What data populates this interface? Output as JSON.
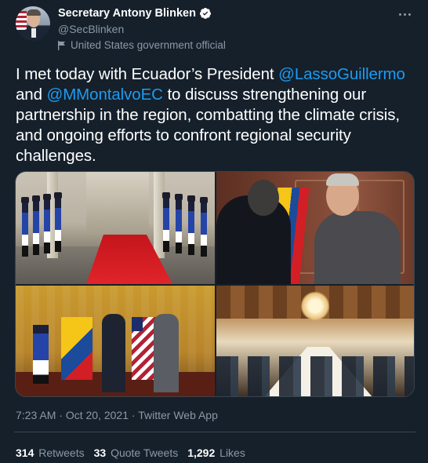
{
  "author": {
    "display_name": "Secretary Antony Blinken",
    "handle": "@SecBlinken",
    "gov_label": "United States government official",
    "verified_icon": "verified-badge-icon",
    "avatar_icon": "avatar"
  },
  "tweet": {
    "text_part1": "I met today with Ecuador’s President ",
    "mention1": "@LassoGuillermo",
    "text_part2": " and ",
    "mention2": "@MMontalvoEC",
    "text_part3": " to discuss strengthening our partnership in the region, combatting the climate crisis, and ongoing efforts to confront regional security challenges."
  },
  "meta": {
    "time": "7:23 AM",
    "separator1": " · ",
    "date": "Oct 20, 2021",
    "separator2": " · ",
    "source": "Twitter Web App"
  },
  "stats": {
    "retweets_count": "314",
    "retweets_label": "Retweets",
    "quotes_count": "33",
    "quotes_label": "Quote Tweets",
    "likes_count": "1,292",
    "likes_label": "Likes"
  },
  "colors": {
    "background": "#15202b",
    "link": "#1d9bf0",
    "secondary_text": "#8b98a5",
    "border": "#38444d"
  }
}
